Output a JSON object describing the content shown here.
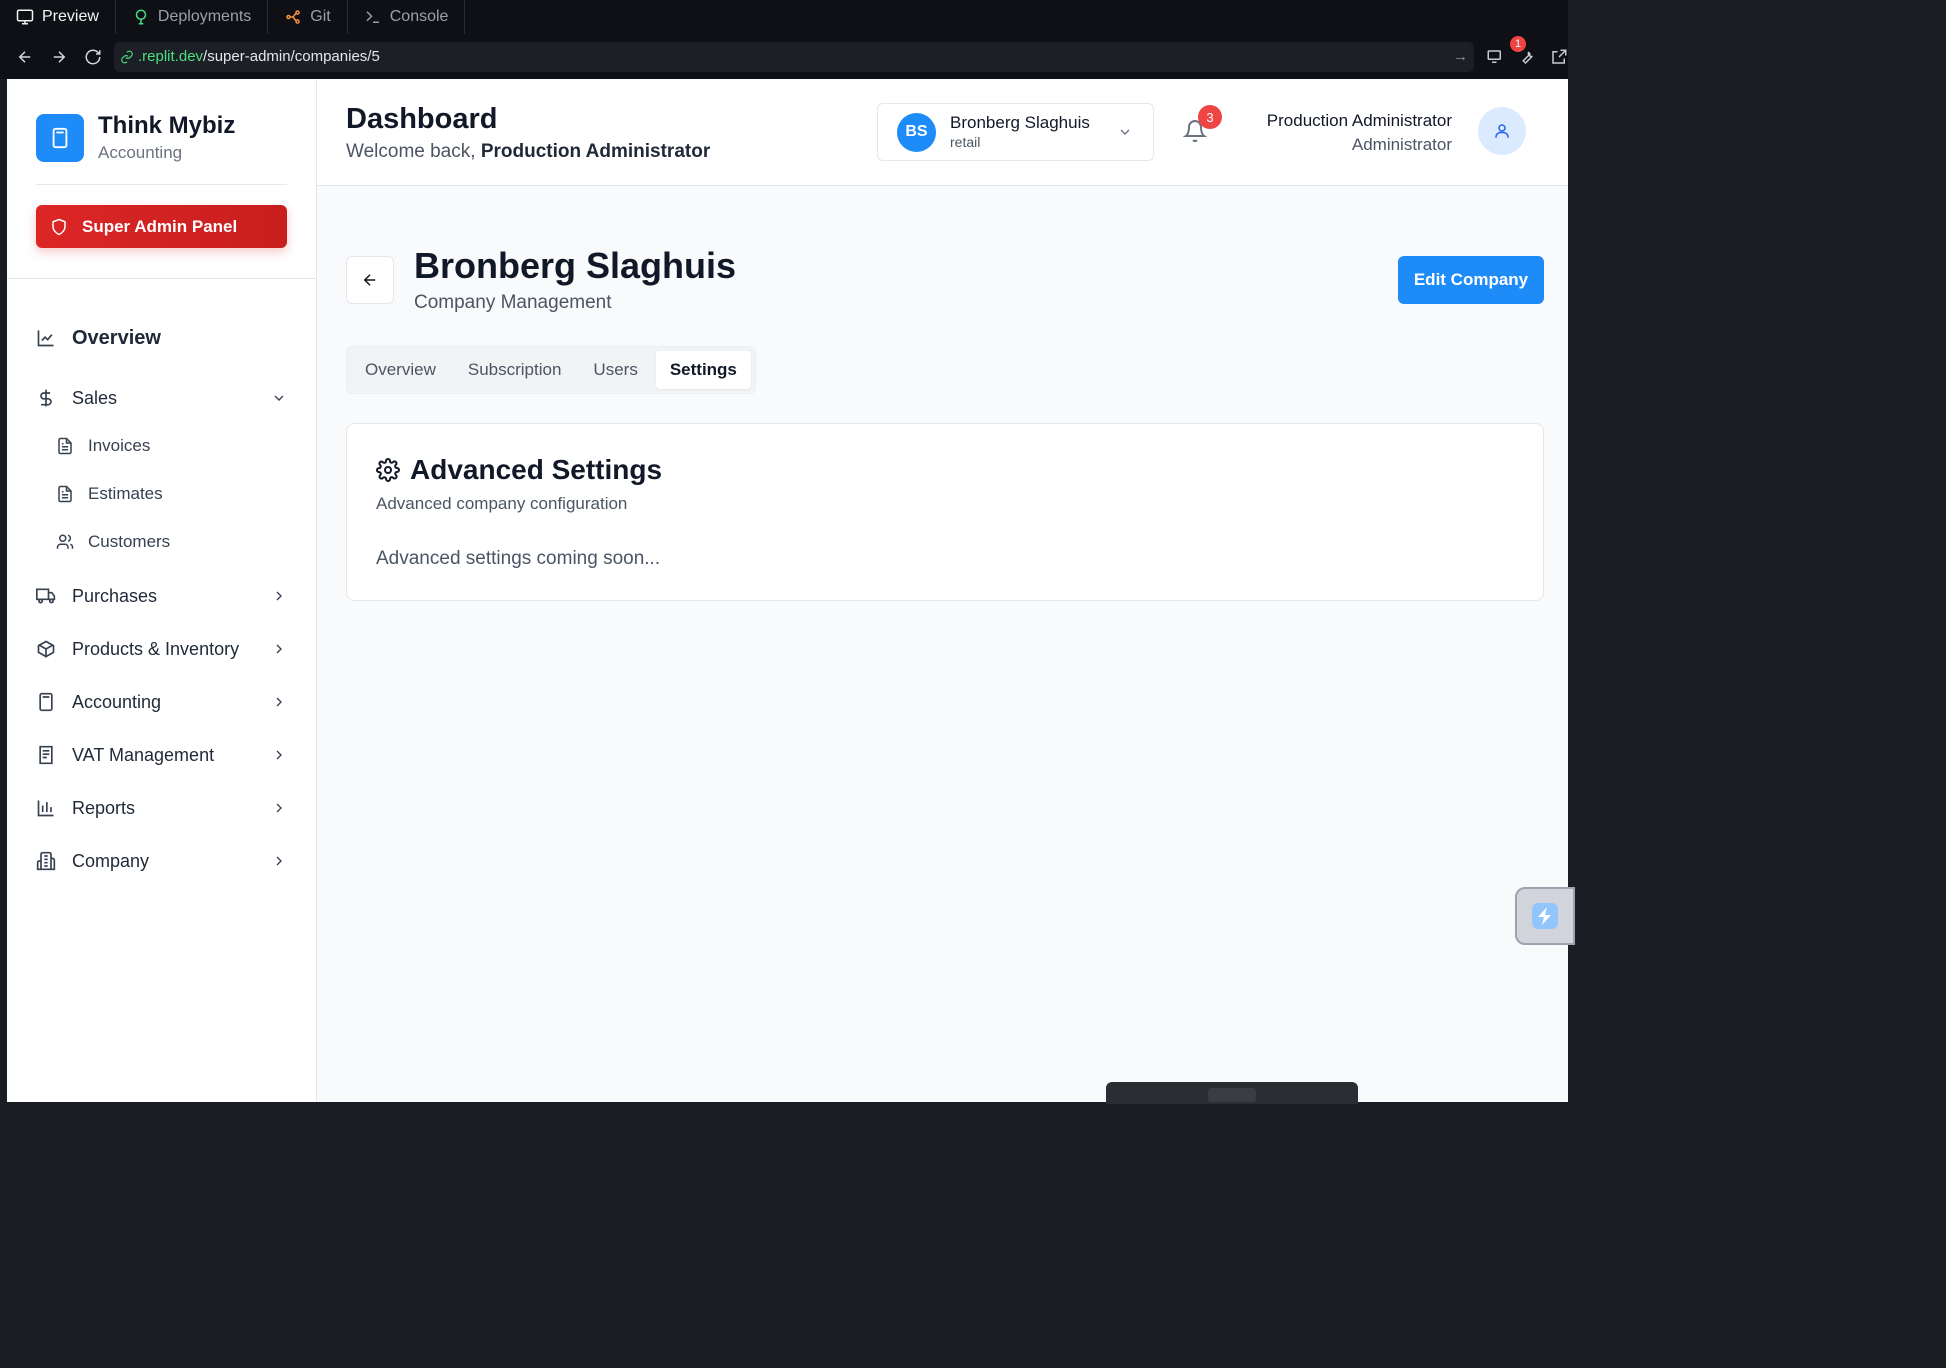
{
  "browser": {
    "tabs": [
      {
        "label": "Preview",
        "icon": "monitor-icon"
      },
      {
        "label": "Deployments",
        "icon": "deploy-icon"
      },
      {
        "label": "Git",
        "icon": "git-icon"
      },
      {
        "label": "Console",
        "icon": "terminal-icon"
      }
    ],
    "url_domain": ".replit.dev",
    "url_path": "/super-admin/companies/5",
    "devtools_badge": "1"
  },
  "sidebar": {
    "brand_name": "Think Mybiz",
    "brand_sub": "Accounting",
    "super_admin_label": "Super Admin Panel",
    "items": [
      {
        "label": "Overview",
        "icon": "chart-line-icon"
      },
      {
        "label": "Sales",
        "icon": "dollar-icon"
      },
      {
        "label": "Invoices",
        "icon": "file-text-icon"
      },
      {
        "label": "Estimates",
        "icon": "file-text-icon"
      },
      {
        "label": "Customers",
        "icon": "users-icon"
      },
      {
        "label": "Purchases",
        "icon": "truck-icon"
      },
      {
        "label": "Products & Inventory",
        "icon": "package-icon"
      },
      {
        "label": "Accounting",
        "icon": "calculator-icon"
      },
      {
        "label": "VAT Management",
        "icon": "receipt-icon"
      },
      {
        "label": "Reports",
        "icon": "bar-chart-icon"
      },
      {
        "label": "Company",
        "icon": "building-icon"
      }
    ]
  },
  "header": {
    "title": "Dashboard",
    "welcome_prefix": "Welcome back,",
    "welcome_name": "Production Administrator",
    "company_initials": "BS",
    "company_name": "Bronberg Slaghuis",
    "company_type": "retail",
    "notification_count": "3",
    "user_name": "Production Administrator",
    "user_role": "Administrator"
  },
  "main": {
    "title": "Bronberg Slaghuis",
    "subtitle": "Company Management",
    "edit_label": "Edit Company",
    "tabs": [
      {
        "label": "Overview"
      },
      {
        "label": "Subscription"
      },
      {
        "label": "Users"
      },
      {
        "label": "Settings"
      }
    ],
    "active_tab": "Settings",
    "card": {
      "title": "Advanced Settings",
      "subtitle": "Advanced company configuration",
      "body": "Advanced settings coming soon..."
    }
  },
  "colors": {
    "accent": "#1d8cf8",
    "danger": "#dc2626",
    "chrome_bg": "#0e1015"
  }
}
